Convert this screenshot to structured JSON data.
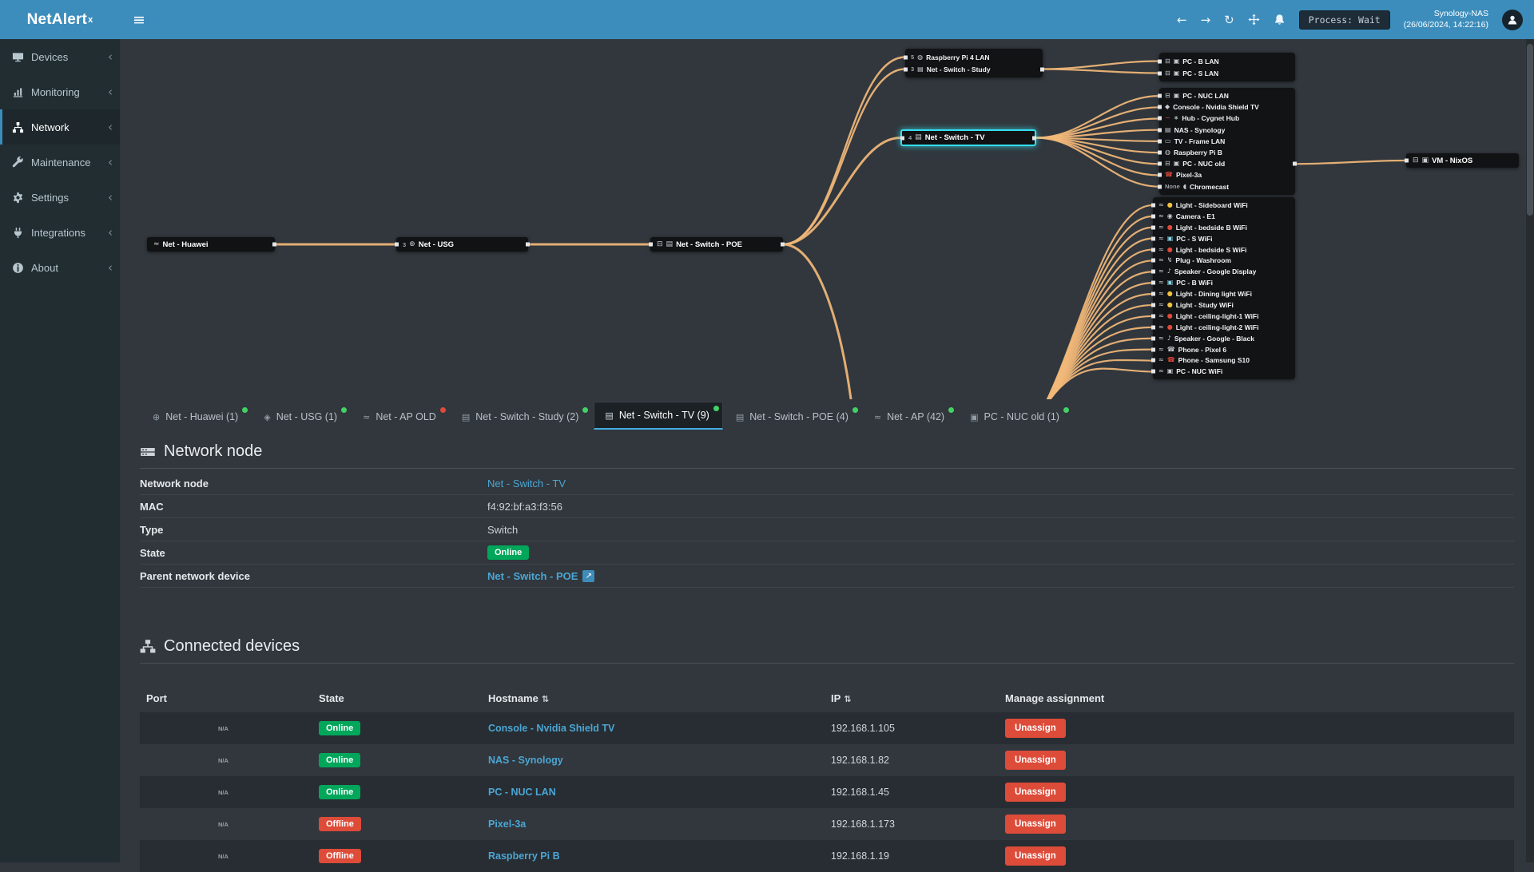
{
  "colors": {
    "header": "#3c8dbc",
    "online": "#00a65a",
    "offline": "#dd4b39",
    "wire": "#f2b878",
    "selected": "#35dff0",
    "online_dot": "#44d164",
    "offline_dot": "#e0493c",
    "link": "#4ba6d4"
  },
  "header": {
    "logo": "NetAlert",
    "logo_sup": "x",
    "process_label": "Process: Wait",
    "host": "Synology-NAS",
    "timestamp": "(26/06/2024, 14:22:16)"
  },
  "sidebar": {
    "items": [
      {
        "label": "Devices",
        "icon": "devices"
      },
      {
        "label": "Monitoring",
        "icon": "monitoring"
      },
      {
        "label": "Network",
        "icon": "network",
        "active": true
      },
      {
        "label": "Maintenance",
        "icon": "maintenance"
      },
      {
        "label": "Settings",
        "icon": "settings"
      },
      {
        "label": "Integrations",
        "icon": "integrations"
      },
      {
        "label": "About",
        "icon": "about"
      }
    ]
  },
  "diagram": {
    "nodes": {
      "huawei": {
        "label": "Net - Huawei",
        "icons": [
          {
            "name": "wifi"
          }
        ]
      },
      "usg": {
        "label": "Net - USG",
        "port": "3",
        "icons": [
          {
            "name": "globe"
          }
        ]
      },
      "poe": {
        "label": "Net - Switch - POE",
        "icons": [
          {
            "name": "ethernet"
          },
          {
            "name": "switch"
          }
        ]
      },
      "tv": {
        "label": "Net - Switch - TV",
        "port": "4",
        "icons": [
          {
            "name": "switch"
          }
        ],
        "selected": true
      },
      "vm": {
        "label": "VM - NixOS",
        "icons": [
          {
            "name": "ethernet"
          },
          {
            "name": "pc"
          }
        ]
      }
    },
    "groups": {
      "top": [
        {
          "port": "5",
          "icons": [
            {
              "name": "raspberry"
            }
          ],
          "label": "Raspberry Pi 4 LAN"
        },
        {
          "port": "3",
          "icons": [
            {
              "name": "switch"
            }
          ],
          "label": "Net - Switch - Study"
        }
      ],
      "pcs": [
        {
          "icons": [
            {
              "name": "ethernet"
            },
            {
              "name": "pc"
            }
          ],
          "label": "PC - B LAN"
        },
        {
          "icons": [
            {
              "name": "ethernet"
            },
            {
              "name": "pc"
            }
          ],
          "label": "PC - S LAN"
        }
      ],
      "box1": [
        {
          "icons": [
            {
              "name": "ethernet"
            },
            {
              "name": "pc"
            }
          ],
          "label": "PC - NUC LAN"
        },
        {
          "icons": [
            {
              "name": "console"
            }
          ],
          "label": "Console - Nvidia Shield TV"
        },
        {
          "icons": [
            {
              "name": "minus",
              "color": "#e0493c"
            },
            {
              "name": "hub"
            }
          ],
          "label": "Hub - Cygnet Hub"
        },
        {
          "icons": [
            {
              "name": "nas"
            }
          ],
          "label": "NAS - Synology"
        },
        {
          "icons": [
            {
              "name": "tv"
            }
          ],
          "label": "TV - Frame LAN"
        },
        {
          "icons": [
            {
              "name": "raspberry"
            }
          ],
          "label": "Raspberry Pi B"
        },
        {
          "icons": [
            {
              "name": "ethernet"
            },
            {
              "name": "pc"
            }
          ],
          "label": "PC - NUC old"
        },
        {
          "icons": [
            {
              "name": "phone",
              "color": "#e0493c"
            }
          ],
          "label": "Pixel-3a"
        },
        {
          "port": "None",
          "icons": [
            {
              "name": "cast"
            }
          ],
          "label": "Chromecast"
        }
      ],
      "wifi": [
        {
          "icons": [
            {
              "name": "wifi"
            },
            {
              "name": "bulb",
              "color": "#f0c242"
            }
          ],
          "label": "Light - Sideboard WiFi"
        },
        {
          "icons": [
            {
              "name": "wifi"
            },
            {
              "name": "camera"
            }
          ],
          "label": "Camera - E1"
        },
        {
          "icons": [
            {
              "name": "wifi"
            },
            {
              "name": "bulb",
              "color": "#e0493c"
            }
          ],
          "label": "Light - bedside B WiFi"
        },
        {
          "icons": [
            {
              "name": "wifi"
            },
            {
              "name": "pc",
              "color": "#86d7e8"
            }
          ],
          "label": "PC - S WiFi"
        },
        {
          "icons": [
            {
              "name": "wifi"
            },
            {
              "name": "bulb",
              "color": "#e0493c"
            }
          ],
          "label": "Light - bedside S WiFi"
        },
        {
          "icons": [
            {
              "name": "wifi"
            },
            {
              "name": "plug"
            }
          ],
          "label": "Plug - Washroom"
        },
        {
          "icons": [
            {
              "name": "wifi"
            },
            {
              "name": "speaker"
            }
          ],
          "label": "Speaker - Google Display"
        },
        {
          "icons": [
            {
              "name": "wifi"
            },
            {
              "name": "pc",
              "color": "#86d7e8"
            }
          ],
          "label": "PC - B WiFi"
        },
        {
          "icons": [
            {
              "name": "wifi"
            },
            {
              "name": "bulb",
              "color": "#f0c242"
            }
          ],
          "label": "Light - Dining light WiFi"
        },
        {
          "icons": [
            {
              "name": "wifi"
            },
            {
              "name": "bulb",
              "color": "#f0c242"
            }
          ],
          "label": "Light - Study WiFi"
        },
        {
          "icons": [
            {
              "name": "wifi"
            },
            {
              "name": "bulb",
              "color": "#e0493c"
            }
          ],
          "label": "Light - ceiling-light-1 WiFi"
        },
        {
          "icons": [
            {
              "name": "wifi"
            },
            {
              "name": "bulb",
              "color": "#e0493c"
            }
          ],
          "label": "Light - ceiling-light-2 WiFi"
        },
        {
          "icons": [
            {
              "name": "wifi"
            },
            {
              "name": "speaker"
            }
          ],
          "label": "Speaker - Google - Black"
        },
        {
          "icons": [
            {
              "name": "wifi"
            },
            {
              "name": "phone"
            }
          ],
          "label": "Phone - Pixel 6"
        },
        {
          "icons": [
            {
              "name": "wifi"
            },
            {
              "name": "phone",
              "color": "#e0493c"
            }
          ],
          "label": "Phone - Samsung S10"
        },
        {
          "icons": [
            {
              "name": "wifi"
            },
            {
              "name": "pc"
            }
          ],
          "label": "PC - NUC WiFi"
        }
      ]
    }
  },
  "tabs": [
    {
      "icon": "globe",
      "label": "Net - Huawei (1)",
      "dot": "green"
    },
    {
      "icon": "usg",
      "label": "Net - USG (1)",
      "dot": "green"
    },
    {
      "icon": "wifi",
      "label": "Net - AP OLD",
      "dot": "red"
    },
    {
      "icon": "switch",
      "label": "Net - Switch - Study (2)",
      "dot": "green"
    },
    {
      "icon": "switch",
      "label": "Net - Switch - TV (9)",
      "dot": "green",
      "active": true
    },
    {
      "icon": "switch",
      "label": "Net - Switch - POE (4)",
      "dot": "green"
    },
    {
      "icon": "wifi",
      "label": "Net - AP (42)",
      "dot": "green"
    },
    {
      "icon": "pc",
      "label": "PC - NUC old (1)",
      "dot": "green"
    }
  ],
  "node_details": {
    "title": "Network node",
    "rows": [
      {
        "label": "Network node",
        "type": "link",
        "value": "Net - Switch - TV"
      },
      {
        "label": "MAC",
        "type": "text",
        "value": "f4:92:bf:a3:f3:56"
      },
      {
        "label": "Type",
        "type": "text",
        "value": "Switch"
      },
      {
        "label": "State",
        "type": "badge",
        "value": "Online"
      },
      {
        "label": "Parent network device",
        "type": "extlink",
        "value": "Net - Switch - POE"
      }
    ]
  },
  "connected": {
    "title": "Connected devices",
    "columns": [
      {
        "label": "Port"
      },
      {
        "label": "State"
      },
      {
        "label": "Hostname",
        "sort": true
      },
      {
        "label": "IP",
        "sort": true
      },
      {
        "label": "Manage assignment"
      }
    ],
    "rows": [
      {
        "port": "N/A",
        "state": "Online",
        "hostname": "Console - Nvidia Shield TV",
        "ip": "192.168.1.105",
        "action": "Unassign"
      },
      {
        "port": "N/A",
        "state": "Online",
        "hostname": "NAS - Synology",
        "ip": "192.168.1.82",
        "action": "Unassign"
      },
      {
        "port": "N/A",
        "state": "Online",
        "hostname": "PC - NUC LAN",
        "ip": "192.168.1.45",
        "action": "Unassign"
      },
      {
        "port": "N/A",
        "state": "Offline",
        "hostname": "Pixel-3a",
        "ip": "192.168.1.173",
        "action": "Unassign"
      },
      {
        "port": "N/A",
        "state": "Offline",
        "hostname": "Raspberry Pi B",
        "ip": "192.168.1.19",
        "action": "Unassign"
      }
    ]
  }
}
